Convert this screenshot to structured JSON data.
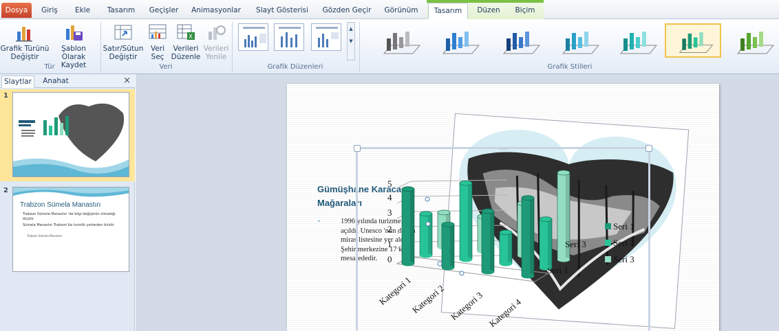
{
  "tabs": [
    "Dosya",
    "Giriş",
    "Ekle",
    "Tasarım",
    "Geçişler",
    "Animasyonlar",
    "Slayt Gösterisi",
    "Gözden Geçir",
    "Görünüm",
    "Tasarım",
    "Düzen",
    "Biçim"
  ],
  "ribbon": {
    "buttons": {
      "change_chart_type": "Grafik Türünü Değiştir",
      "save_template": "Şablon Olarak Kaydet",
      "switch_row_col": "Satır/Sütun Değiştir",
      "select_data": "Veri Seç",
      "edit_data": "Verileri Düzenle",
      "refresh_data": "Verileri Yenile"
    },
    "groups": {
      "type": "Tür",
      "data": "Veri",
      "layouts": "Grafik Düzenleri",
      "styles": "Grafik Stilleri"
    }
  },
  "leftpane": {
    "tabs": [
      "Slaytlar",
      "Anahat"
    ],
    "close": "×",
    "slides": [
      {
        "num": "1",
        "title": "Gümüşhane Karaca Mağaraları"
      },
      {
        "num": "2",
        "title": "Trabzon Sümela Manastırı",
        "bullets": [
          "Trabzon Sümela Manastırı 'de bilgi değişimin olmadığı ölçütü",
          "Sümela Manastırı Trabzon'da turistik yerlerden biridir",
          "Trabzon Sümela Manastırı"
        ]
      }
    ]
  },
  "slide": {
    "title": "Gümüşhane Karaca Mağaraları",
    "bullet_marker": "•",
    "body": "1996 yılında turizme açıldı. Unesco 'nun dünya miras listesine yer aldı. Şehir merkezine 17 km. mesafededir.",
    "handle_dots": "....",
    "chart": {
      "legend": [
        "Seri 1",
        "Seri 2",
        "Seri 3"
      ],
      "categories": [
        "Kategori 1",
        "Kategori 2",
        "Kategori 3",
        "Kategori 4"
      ],
      "y_ticks": [
        "5",
        "4",
        "3",
        "2",
        "1",
        "0"
      ],
      "series_axis_labels": [
        "Seri 3",
        "Seri 1"
      ]
    }
  },
  "colors": {
    "seri1": "#1e9a78",
    "seri2": "#27c498",
    "seri3": "#93ddc0",
    "accent_file": "#d04f2e",
    "context_green": "#7ac043"
  },
  "chart_data": {
    "type": "bar",
    "categories": [
      "Kategori 1",
      "Kategori 2",
      "Kategori 3",
      "Kategori 4"
    ],
    "series": [
      {
        "name": "Seri 1",
        "values": [
          4.3,
          2.5,
          3.5,
          4.5
        ]
      },
      {
        "name": "Seri 2",
        "values": [
          2.4,
          4.4,
          1.8,
          2.8
        ]
      },
      {
        "name": "Seri 3",
        "values": [
          2,
          2,
          3,
          5
        ]
      }
    ],
    "ylim": [
      0,
      5
    ],
    "grid": true,
    "legend_position": "right"
  }
}
